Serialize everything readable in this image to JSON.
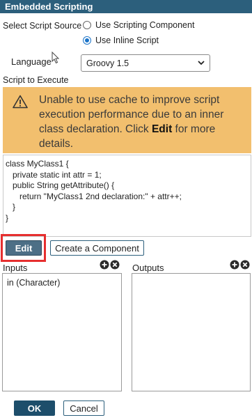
{
  "dialog": {
    "title": "Embedded Scripting"
  },
  "source": {
    "label": "Select Script Source",
    "options": [
      {
        "label": "Use Scripting Component",
        "checked": false
      },
      {
        "label": "Use Inline Script",
        "checked": true
      }
    ]
  },
  "language": {
    "label": "Language",
    "selected": "Groovy 1.5"
  },
  "script": {
    "label": "Script to Execute",
    "warning": {
      "before": "Unable to use cache to improve script execution performance due to an inner class declaration. Click ",
      "bold": "Edit",
      "after": " for more details."
    },
    "code_lines": [
      "class MyClass1 {",
      "   private static int attr = 1;",
      "",
      "   public String getAttribute() {",
      "      return \"MyClass1 2nd declaration:\" + attr++;",
      "   }",
      "}"
    ]
  },
  "buttons": {
    "edit": "Edit",
    "create_component": "Create a Component",
    "ok": "OK",
    "cancel": "Cancel"
  },
  "inputs": {
    "label": "Inputs",
    "items": [
      "in (Character)"
    ]
  },
  "outputs": {
    "label": "Outputs",
    "items": []
  },
  "colors": {
    "titlebar": "#2c5f7c",
    "warning": "#f2bf6e",
    "highlight": "#e62e2e",
    "ok_button": "#1d4e6b"
  }
}
